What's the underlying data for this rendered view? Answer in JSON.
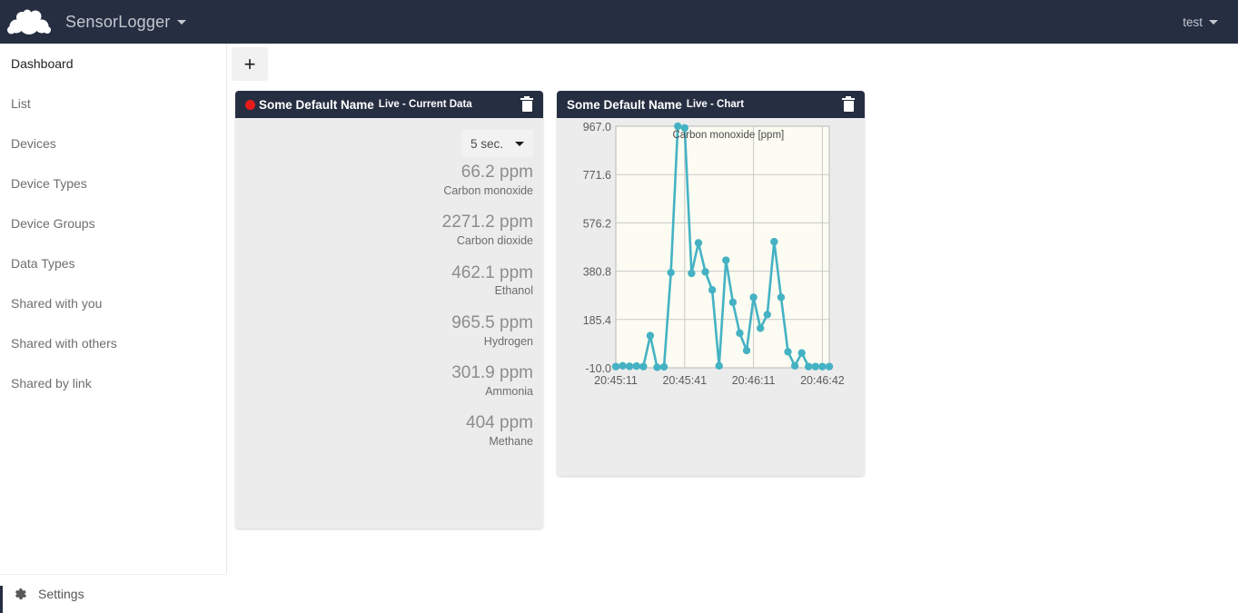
{
  "topbar": {
    "logo_icon": "owncloud-logo-icon",
    "brand": "SensorLogger",
    "brand_caret_icon": "caret-down-icon",
    "user": "test",
    "user_caret_icon": "caret-down-icon",
    "bg": "#262e42"
  },
  "sidebar": {
    "items": [
      {
        "label": "Dashboard",
        "active": true
      },
      {
        "label": "List",
        "active": false
      },
      {
        "label": "Devices",
        "active": false
      },
      {
        "label": "Device Types",
        "active": false
      },
      {
        "label": "Device Groups",
        "active": false
      },
      {
        "label": "Data Types",
        "active": false
      },
      {
        "label": "Shared with you",
        "active": false
      },
      {
        "label": "Shared with others",
        "active": false
      },
      {
        "label": "Shared by link",
        "active": false
      }
    ],
    "settings": {
      "label": "Settings",
      "icon": "gear-icon"
    }
  },
  "main": {
    "add_button": {
      "label": "+",
      "icon": "plus-icon"
    },
    "widgets": [
      {
        "id": "current",
        "title": "Some Default Name",
        "subtitle": "Live - Current Data",
        "recording": true,
        "delete_icon": "trash-icon",
        "interval": {
          "value": "5 sec.",
          "caret_icon": "caret-down-icon"
        },
        "readings": [
          {
            "value": "66.2 ppm",
            "name": "Carbon monoxide"
          },
          {
            "value": "2271.2 ppm",
            "name": "Carbon dioxide"
          },
          {
            "value": "462.1 ppm",
            "name": "Ethanol"
          },
          {
            "value": "965.5 ppm",
            "name": "Hydrogen"
          },
          {
            "value": "301.9 ppm",
            "name": "Ammonia"
          },
          {
            "value": "404 ppm",
            "name": "Methane"
          }
        ]
      },
      {
        "id": "chart",
        "title": "Some Default Name",
        "subtitle": "Live - Chart",
        "recording": false,
        "delete_icon": "trash-icon"
      }
    ]
  },
  "chart_data": {
    "type": "line",
    "title": "Carbon monoxide [ppm]",
    "series_name": "Carbon monoxide [ppm]",
    "xlabel": "",
    "ylabel": "",
    "ylim": [
      -10.0,
      967.0
    ],
    "ytick_labels": [
      "967.0",
      "771.6",
      "576.2",
      "380.8",
      "185.4",
      "-10.0"
    ],
    "yticks": [
      967.0,
      771.6,
      576.2,
      380.8,
      185.4,
      -10.0
    ],
    "xtick_labels": [
      "20:45:11",
      "20:45:41",
      "20:46:11",
      "20:46:42"
    ],
    "xticks": [
      0,
      10,
      20,
      30
    ],
    "grid": true,
    "legend_position": "top-center-inside",
    "line_color": "#45b2c4",
    "marker_color": "#45b2c4",
    "plot_bg": "#fcfcf2",
    "x": [
      0,
      1,
      2,
      3,
      4,
      5,
      6,
      7,
      8,
      9,
      10,
      11,
      12,
      13,
      14,
      15,
      16,
      17,
      18,
      19,
      20,
      21,
      22,
      23,
      24,
      25,
      26,
      27,
      28,
      29,
      30,
      31
    ],
    "values": [
      -5,
      -2,
      -4,
      -3,
      -5,
      120,
      -8,
      -6,
      375,
      967,
      960,
      372,
      495,
      378,
      305,
      -2,
      425,
      255,
      130,
      60,
      275,
      150,
      205,
      500,
      275,
      55,
      -2,
      50,
      -5,
      -5,
      -5,
      -5
    ]
  }
}
